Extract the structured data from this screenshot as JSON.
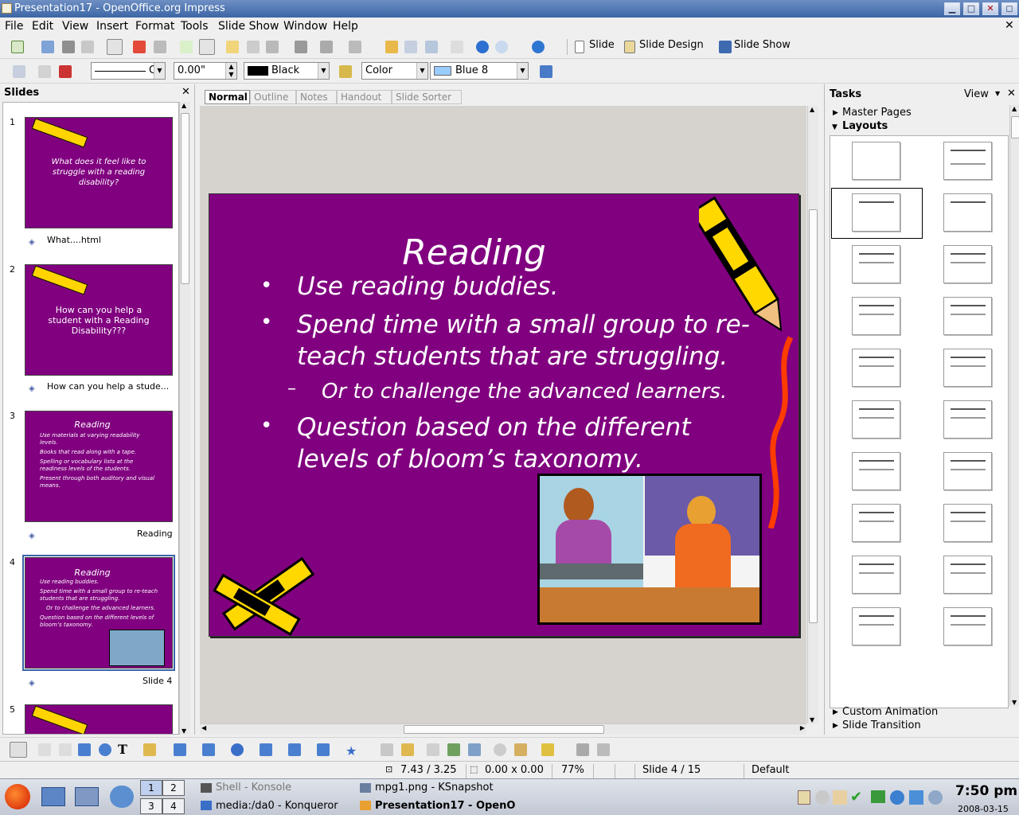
{
  "window": {
    "title": "Presentation17 - OpenOffice.org Impress"
  },
  "menu": [
    "File",
    "Edit",
    "View",
    "Insert",
    "Format",
    "Tools",
    "Slide Show",
    "Window",
    "Help"
  ],
  "toolbar": {
    "slide_label": "Slide",
    "slide_design_label": "Slide Design",
    "slide_show_label": "Slide Show"
  },
  "line_toolbar": {
    "line_style": "C",
    "line_width": "0.00\"",
    "line_color": "Black",
    "area_style": "Color",
    "area_color": "Blue 8"
  },
  "slides_pane": {
    "title": "Slides",
    "slides": [
      {
        "num": "1",
        "text": "What does it feel like to struggle with a reading disability?",
        "label": "What....html"
      },
      {
        "num": "2",
        "text": "How can you help a student with a Reading Disability???",
        "label": "How can you help a stude..."
      },
      {
        "num": "3",
        "title": "Reading",
        "bullets": [
          "Use materials at varying readability levels.",
          "Books that read along with a tape.",
          "Spelling or vocabulary lists at the readiness levels of the students.",
          "Present through both auditory and visual means."
        ],
        "label": "Reading"
      },
      {
        "num": "4",
        "title": "Reading",
        "bullets": [
          "Use reading buddies.",
          "Spend time with a small group to re-teach students that are struggling.",
          "Or to challenge the advanced learners.",
          "Question based on the different levels of bloom’s taxonomy."
        ],
        "label": "Slide 4"
      },
      {
        "num": "5"
      }
    ]
  },
  "view_tabs": [
    "Normal",
    "Outline",
    "Notes",
    "Handout",
    "Slide Sorter"
  ],
  "slide": {
    "title": "Reading",
    "bullet1": "Use reading buddies.",
    "bullet2a": "Spend time with a small group to re-",
    "bullet2b": "teach students that are struggling.",
    "sub": "Or to challenge the advanced learners.",
    "bullet3a": "Question based on the different",
    "bullet3b": "levels of bloom’s taxonomy.",
    "bg_color": "#80007f"
  },
  "tasks": {
    "title": "Tasks",
    "view_label": "View",
    "master_pages": "Master Pages",
    "layouts": "Layouts",
    "custom_animation": "Custom Animation",
    "slide_transition": "Slide Transition"
  },
  "status": {
    "position": "7.43 / 3.25",
    "size": "0.00 x 0.00",
    "zoom": "77%",
    "slide": "Slide 4 / 15",
    "design": "Default"
  },
  "taskbar": {
    "pager": [
      "1",
      "2",
      "3",
      "4"
    ],
    "tasks": [
      "Shell - Konsole",
      "mpg1.png - KSnapshot",
      "media:/da0 - Konqueror",
      "Presentation17 - OpenO"
    ],
    "clock_time": "7:50 pm",
    "clock_date": "2008-03-15"
  }
}
